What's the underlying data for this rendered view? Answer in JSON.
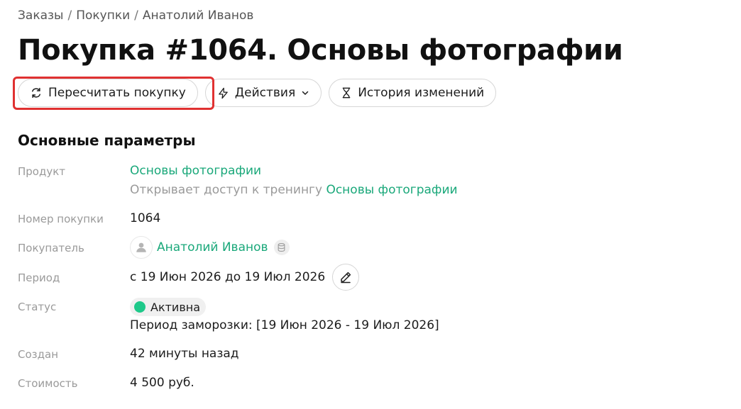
{
  "breadcrumb": {
    "items": [
      "Заказы",
      "Покупки",
      "Анатолий Иванов"
    ],
    "separator": "/"
  },
  "page": {
    "title": "Покупка #1064. Основы фотографии"
  },
  "toolbar": {
    "recalc_label": "Пересчитать покупку",
    "actions_label": "Действия",
    "history_label": "История изменений"
  },
  "section": {
    "title": "Основные параметры"
  },
  "params": {
    "product": {
      "label": "Продукт",
      "name": "Основы фотографии",
      "desc_prefix": "Открывает доступ к тренингу",
      "training_link": "Основы фотографии"
    },
    "number": {
      "label": "Номер покупки",
      "value": "1064"
    },
    "buyer": {
      "label": "Покупатель",
      "name": "Анатолий Иванов"
    },
    "period": {
      "label": "Период",
      "value": "с 19 Июн 2026 до 19 Июл 2026"
    },
    "status": {
      "label": "Статус",
      "value": "Активна",
      "freeze": "Период заморозки: [19 Июн 2026 - 19 Июл 2026]"
    },
    "created": {
      "label": "Создан",
      "value": "42 минуты назад"
    },
    "cost": {
      "label": "Стоимость",
      "value": "4 500 руб."
    }
  },
  "colors": {
    "link": "#1aa87a",
    "status_active": "#1ec98a",
    "highlight": "#e03131"
  },
  "icons": {
    "recalc": "refresh-icon",
    "actions": "lightning-icon",
    "actions_caret": "chevron-down-icon",
    "history": "hourglass-icon",
    "edit": "pencil-icon",
    "avatar": "user-icon",
    "database": "database-icon"
  }
}
